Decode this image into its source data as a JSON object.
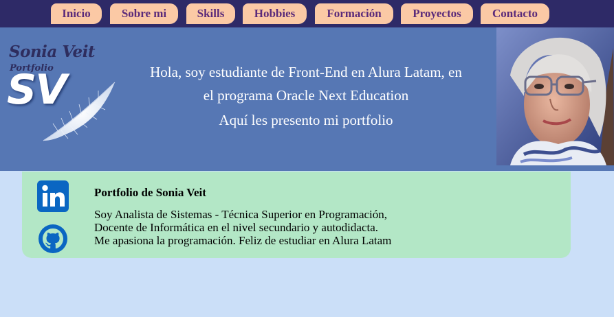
{
  "nav": {
    "items": [
      {
        "label": "Inicio"
      },
      {
        "label": "Sobre mi"
      },
      {
        "label": "Skills"
      },
      {
        "label": "Hobbies"
      },
      {
        "label": "Formación"
      },
      {
        "label": "Proyectos"
      },
      {
        "label": "Contacto"
      }
    ]
  },
  "hero": {
    "logo_name": "Sonia Veit",
    "logo_sub": "Portfolio",
    "logo_initials": "SV",
    "lines": [
      "Hola, soy estudiante de Front-End en Alura Latam, en el programa Oracle Next Education",
      "Aquí les presento mi portfolio"
    ]
  },
  "card": {
    "title": "Portfolio de Sonia Veit",
    "body": [
      "Soy Analista de Sistemas - Técnica Superior en Programación,",
      "Docente de Informática en el nivel secundario y autodidacta.",
      "Me apasiona la programación. Feliz de estudiar en Alura Latam"
    ],
    "social": [
      {
        "icon": "linkedin-icon",
        "color": "#0a66c2"
      },
      {
        "icon": "github-icon",
        "color": "#0a66c2"
      }
    ]
  },
  "colors": {
    "nav_bg": "#2e2a67",
    "nav_button": "#fbc9a5",
    "nav_text": "#5a2a7a",
    "hero_bg": "#5677b4",
    "card_bg": "#b3e7c6",
    "page_bg": "#cbdff8"
  }
}
